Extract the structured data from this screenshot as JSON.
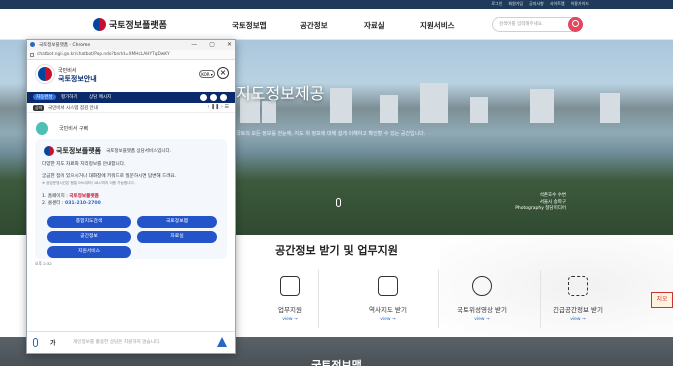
{
  "util_links": [
    "로그인",
    "회원가입",
    "공지사항",
    "사이트맵",
    "이용가이드"
  ],
  "header": {
    "logo": "국토정보플랫폼",
    "nav": [
      "국토정보맵",
      "공간정보",
      "자료실",
      "지원서비스"
    ],
    "search_placeholder": "검색어를 입력해주세요."
  },
  "hero": {
    "title": "지도정보제공",
    "subtitle": "국토의 모든 정보를 한눈에, 지도 위 정보에 대해 쉽게 이해하고 확인할 수 있는 공간입니다.",
    "caption": [
      "석촌호수 수변",
      "서울시 송파구",
      "Photography 청담미디어"
    ]
  },
  "services": {
    "title": "공간정보 받기 및 업무지원",
    "items": [
      {
        "icon": "chart-icon",
        "label": "업무지원",
        "view": "view →"
      },
      {
        "icon": "map-icon",
        "label": "역사지도 받기",
        "view": "view →"
      },
      {
        "icon": "satellite-icon",
        "label": "국토위성영상 받기",
        "view": "view →"
      },
      {
        "icon": "korea-map-icon",
        "label": "긴급공간정보 받기",
        "view": "view →"
      }
    ],
    "side_tag": "지오",
    "bottom_title": "국토정보맵"
  },
  "chat": {
    "window_title": "국토정보플랫폼 - Chrome",
    "url": "chatbot.ngii.go.kr/chatbot/Pop.ndo?bnrId=XMHcLAHYTqDwKY",
    "controls": [
      "—",
      "▢",
      "✕"
    ],
    "org_small": "국민비서",
    "org_name": "국토정보안내",
    "lang_btn": "KOR ▾",
    "tabs": [
      "자동완성",
      "평가하기",
      "상담 메시지"
    ],
    "notice_badge": "공지",
    "notice_text": "국민비서 시스템 점검 안내",
    "notice_arrows": "‹ ❚❚ ›  ☰",
    "bot_name": "국민비서 구삐",
    "card": {
      "name": "국토정보플랫폼",
      "desc": "국토정보플랫폼 상담서비스입니다.",
      "line1": "다양한 지도 자료와 지리정보를 안내합니다.",
      "line2": "궁금한 점이 있으시거나 대화창에 키워드로 질문하시면 답변해 드려요.",
      "line3": "※ 상담운영시간은 평일 09시부터 18시까지 이용 가능합니다.",
      "contact_label": "1. 홈페이지 :",
      "contact_site": "국토정보플랫폼",
      "phone_label": "2. 콜센터 :",
      "phone": "031-210-2700"
    },
    "quick_buttons": [
      "종합지도검색",
      "국토정보맵",
      "공간정보",
      "자료실",
      "지원서비스"
    ],
    "timestamp": "오후 2:32",
    "input_prefix": "가",
    "input_placeholder": "개인정보를 활용한 상담은 지원하지 않습니다."
  }
}
